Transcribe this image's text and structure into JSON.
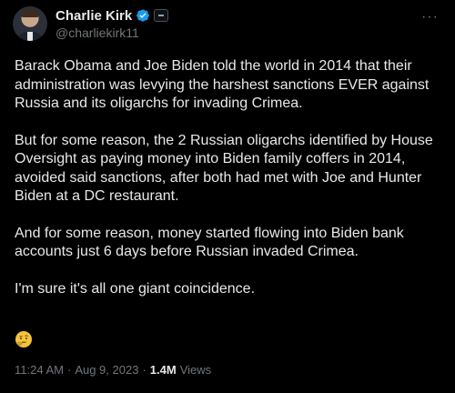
{
  "author": {
    "display_name": "Charlie Kirk",
    "handle": "@charliekirk11",
    "verified": true,
    "verified_color": "#1d9bf0"
  },
  "more_label": "···",
  "tweet": {
    "paragraphs": [
      "Barack Obama and Joe Biden told the world in 2014 that their administration was levying the harshest sanctions EVER against Russia and its oligarchs for invading Crimea.",
      "But for some reason, the 2 Russian oligarchs identified by House Oversight as paying money into Biden family coffers in 2014, avoided said sanctions, after both had met with Joe and Hunter Biden at a DC restaurant.",
      "And for some reason, money started flowing into Biden bank accounts just 6 days before Russian invaded Crimea.",
      "I'm sure it's all one giant coincidence."
    ],
    "emoji": "thinking-face"
  },
  "meta": {
    "time": "11:24 AM",
    "separator1": "·",
    "date": "Aug 9, 2023",
    "separator2": "·",
    "views_count": "1.4M",
    "views_label": "Views"
  }
}
